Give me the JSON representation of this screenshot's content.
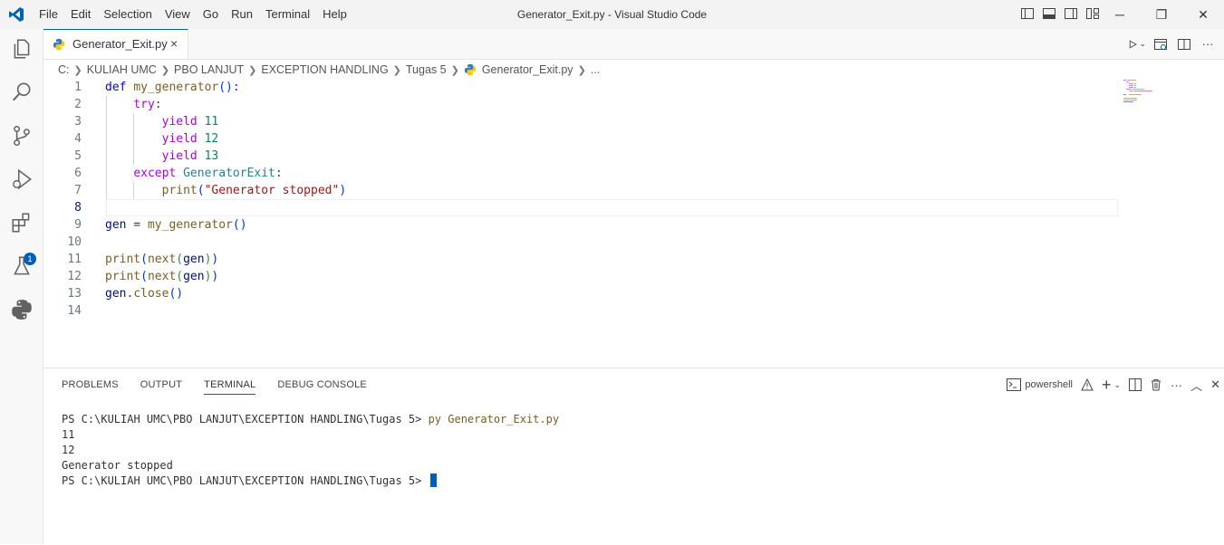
{
  "titlebar": {
    "menu": [
      "File",
      "Edit",
      "Selection",
      "View",
      "Go",
      "Run",
      "Terminal",
      "Help"
    ],
    "window_title": "Generator_Exit.py - Visual Studio Code"
  },
  "activity_bar": {
    "items": [
      "explorer",
      "search",
      "source-control",
      "run-debug",
      "extensions",
      "testing",
      "python"
    ],
    "extensions_badge": "1"
  },
  "editor_tab": {
    "label": "Generator_Exit.py",
    "close": "×"
  },
  "breadcrumb": [
    "C:",
    "KULIAH UMC",
    "PBO LANJUT",
    "EXCEPTION HANDLING",
    "Tugas 5",
    "Generator_Exit.py",
    "..."
  ],
  "code_lines": [
    {
      "n": "1"
    },
    {
      "n": "2"
    },
    {
      "n": "3"
    },
    {
      "n": "4"
    },
    {
      "n": "5"
    },
    {
      "n": "6"
    },
    {
      "n": "7"
    },
    {
      "n": "8"
    },
    {
      "n": "9"
    },
    {
      "n": "10"
    },
    {
      "n": "11"
    },
    {
      "n": "12"
    },
    {
      "n": "13"
    },
    {
      "n": "14"
    }
  ],
  "code": {
    "l1": {
      "def": "def",
      "name": "my_generator",
      "paren": "():"
    },
    "l2": {
      "kw": "try",
      "colon": ":"
    },
    "l3": {
      "kw": "yield",
      "num": "11"
    },
    "l4": {
      "kw": "yield",
      "num": "12"
    },
    "l5": {
      "kw": "yield",
      "num": "13"
    },
    "l6": {
      "kw": "except",
      "cls": "GeneratorExit",
      "colon": ":"
    },
    "l7": {
      "fn": "print",
      "str": "\"Generator stopped\""
    },
    "l9": {
      "var": "gen",
      "eq": " = ",
      "fn": "my_generator",
      "paren": "()"
    },
    "l11": {
      "fn": "print",
      "fn2": "next",
      "var": "gen"
    },
    "l12": {
      "fn": "print",
      "fn2": "next",
      "var": "gen"
    },
    "l13": {
      "var": "gen",
      "dot": ".",
      "fn": "close",
      "paren": "()"
    }
  },
  "panel": {
    "tabs": [
      "PROBLEMS",
      "OUTPUT",
      "TERMINAL",
      "DEBUG CONSOLE"
    ],
    "active_tab": "TERMINAL",
    "shell_name": "powershell"
  },
  "terminal": {
    "prompt1": "PS C:\\KULIAH UMC\\PBO LANJUT\\EXCEPTION HANDLING\\Tugas 5> ",
    "command1": "py Generator_Exit.py",
    "out1": "11",
    "out2": "12",
    "out3": "Generator stopped",
    "prompt2": "PS C:\\KULIAH UMC\\PBO LANJUT\\EXCEPTION HANDLING\\Tugas 5> "
  }
}
